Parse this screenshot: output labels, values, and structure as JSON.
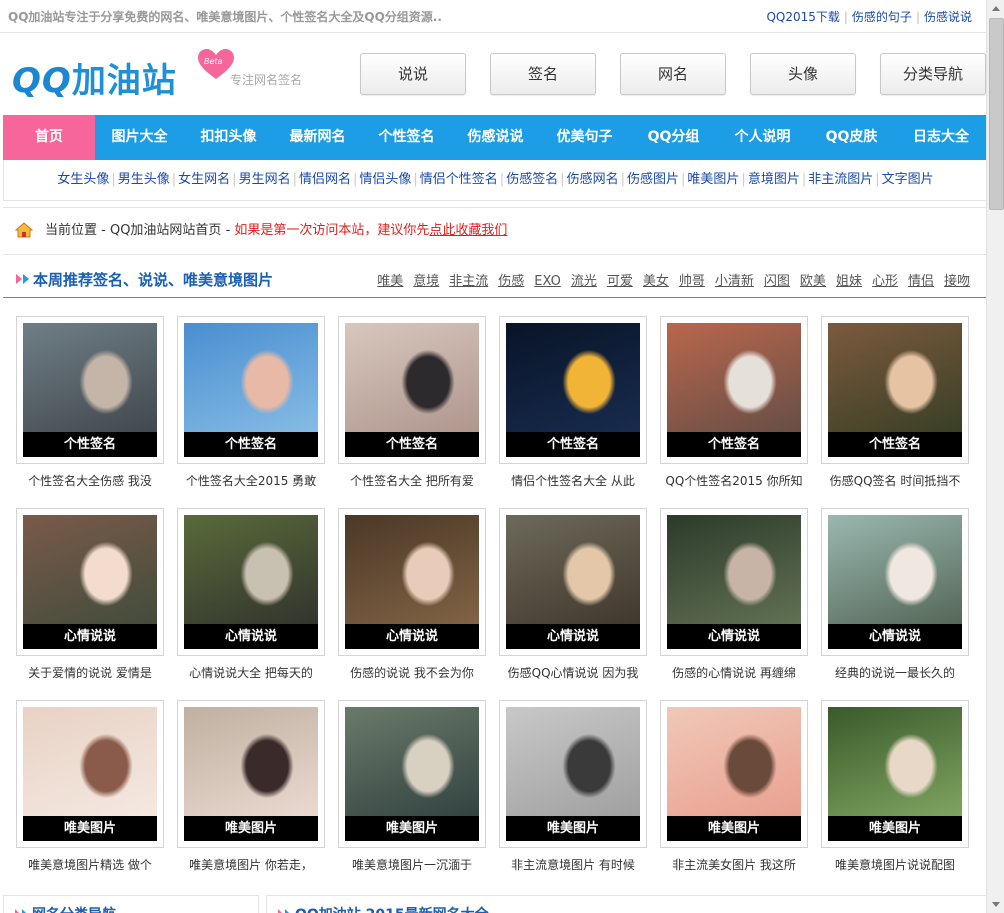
{
  "topbar": {
    "tagline": "QQ加油站专注于分享免费的网名、唯美意境图片、个性签名大全及QQ分组资源..",
    "links": [
      "QQ2015下载",
      "伤感的句子",
      "伤感说说"
    ]
  },
  "logo": {
    "qq": "QQ",
    "name": "加油站",
    "badge": "Beta",
    "sub": "专注网名签名"
  },
  "header_buttons": [
    "说说",
    "签名",
    "网名",
    "头像",
    "分类导航"
  ],
  "main_nav": [
    "首页",
    "图片大全",
    "扣扣头像",
    "最新网名",
    "个性签名",
    "伤感说说",
    "优美句子",
    "QQ分组",
    "个人说明",
    "QQ皮肤",
    "日志大全"
  ],
  "sub_nav": [
    "女生头像",
    "男生头像",
    "女生网名",
    "男生网名",
    "情侣网名",
    "情侣头像",
    "情侣个性签名",
    "伤感签名",
    "伤感网名",
    "伤感图片",
    "唯美图片",
    "意境图片",
    "非主流图片",
    "文字图片"
  ],
  "breadcrumb": {
    "label": "当前位置",
    "path": " - QQ加油站网站首页 - ",
    "warn_prefix": "如果是第一次访问本站，建议你先",
    "warn_link": "点此收藏我们"
  },
  "section": {
    "title": "本周推荐签名、说说、唯美意境图片",
    "tags": [
      "唯美",
      "意境",
      "非主流",
      "伤感",
      "EXO",
      "流光",
      "可爱",
      "美女",
      "帅哥",
      "小清新",
      "闪图",
      "欧美",
      "姐妹",
      "心形",
      "情侣",
      "接吻"
    ]
  },
  "rows": [
    {
      "badge": "个性签名",
      "captions": [
        "个性签名大全伤感 我没",
        "个性签名大全2015 勇敢",
        "个性签名大全 把所有爱",
        "情侣个性签名大全 从此",
        "QQ个性签名2015 你所知",
        "伤感QQ签名 时间抵挡不"
      ]
    },
    {
      "badge": "心情说说",
      "captions": [
        "关于爱情的说说 爱情是",
        "心情说说大全 把每天的",
        "伤感的说说 我不会为你",
        "伤感QQ心情说说 因为我",
        "伤感的心情说说 再缠绵",
        "经典的说说一最长久的"
      ]
    },
    {
      "badge": "唯美图片",
      "captions": [
        "唯美意境图片精选 做个",
        "唯美意境图片 你若走，",
        "唯美意境图片一沉湎于",
        "非主流意境图片 有时候",
        "非主流美女图片 我这所",
        "唯美意境图片说说配图"
      ]
    }
  ],
  "bottom": {
    "left_title": "网名分类导航",
    "right_title": "QQ加油站 2015最新网名大全"
  },
  "colors": {
    "nav_blue": "#1d9de5",
    "nav_active_pink": "#f7669b",
    "link_blue": "#1a4aa8",
    "warn_red": "#e02020"
  }
}
